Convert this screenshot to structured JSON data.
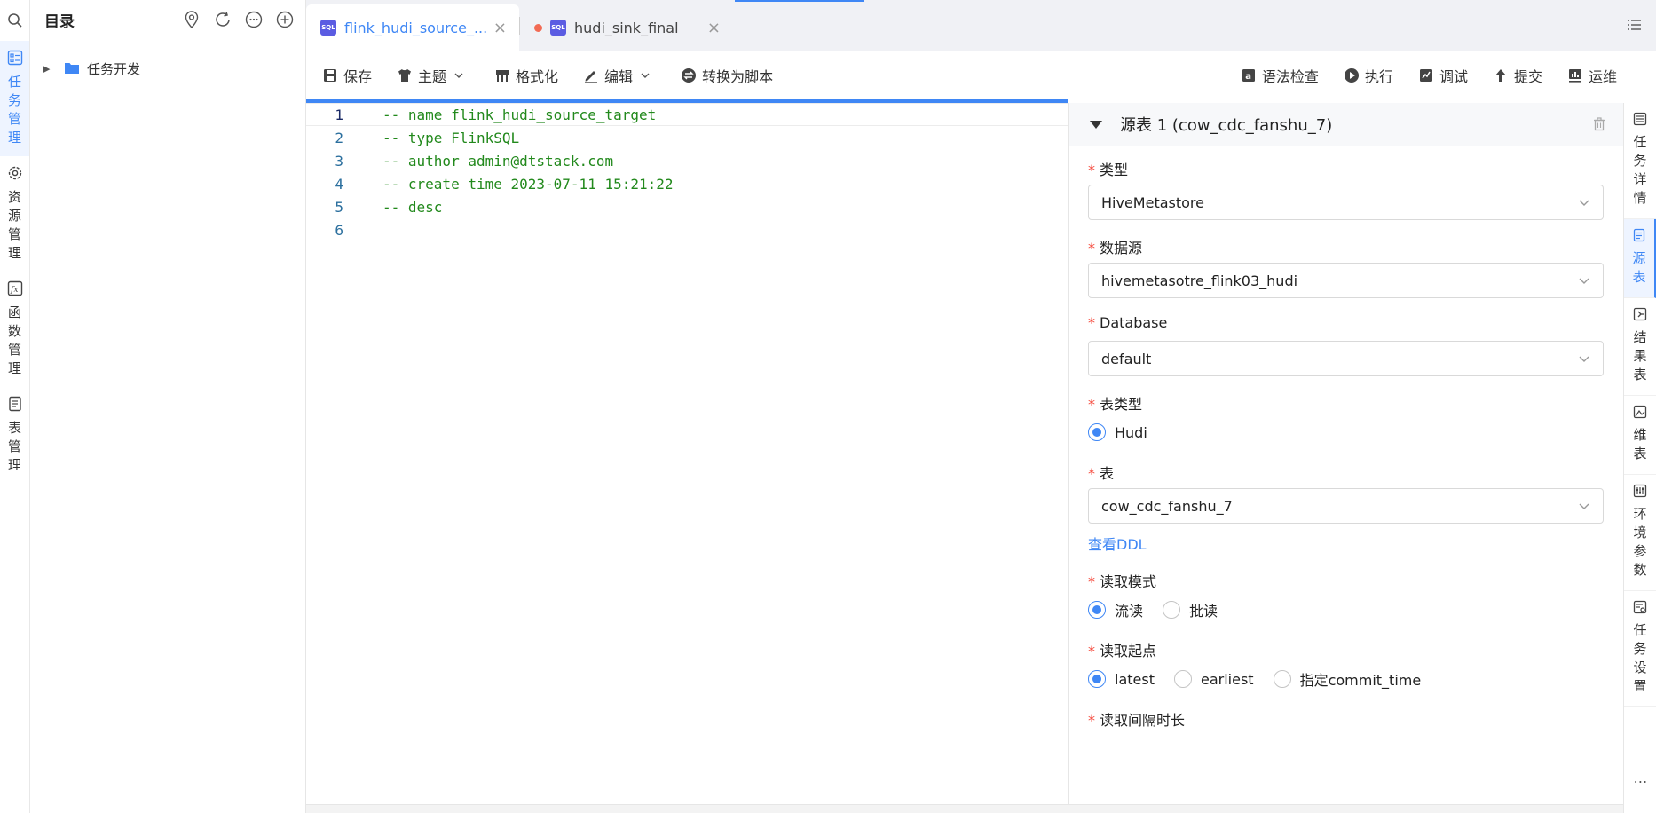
{
  "rail": {
    "items": [
      {
        "label": "任务管理",
        "chars": [
          "任",
          "务",
          "管",
          "理"
        ],
        "icon": "task-list-icon",
        "active": true
      },
      {
        "label": "资源管理",
        "chars": [
          "资",
          "源",
          "管",
          "理"
        ],
        "icon": "gear-icon",
        "active": false
      },
      {
        "label": "函数管理",
        "chars": [
          "函",
          "数",
          "管",
          "理"
        ],
        "icon": "function-icon",
        "active": false
      },
      {
        "label": "表管理",
        "chars": [
          "表",
          "管",
          "理"
        ],
        "icon": "document-icon",
        "active": false
      }
    ]
  },
  "directory": {
    "title": "目录",
    "tree": [
      {
        "label": "任务开发",
        "expanded": false
      }
    ]
  },
  "tabs": [
    {
      "label": "flink_hudi_source_...",
      "badge": "SQL",
      "active": true,
      "unsaved": false
    },
    {
      "label": "hudi_sink_final",
      "badge": "SQL",
      "active": false,
      "unsaved": true
    }
  ],
  "toolbar": {
    "save": "保存",
    "theme": "主题",
    "format": "格式化",
    "edit": "编辑",
    "convert": "转换为脚本",
    "syntax_check": "语法检查",
    "run": "执行",
    "debug": "调试",
    "submit": "提交",
    "ops": "运维"
  },
  "editor": {
    "current_line": 1,
    "lines": [
      {
        "n": "1",
        "text": "-- name flink_hudi_source_target"
      },
      {
        "n": "2",
        "text": "-- type FlinkSQL"
      },
      {
        "n": "3",
        "text": "-- author admin@dtstack.com"
      },
      {
        "n": "4",
        "text": "-- create time 2023-07-11 15:21:22"
      },
      {
        "n": "5",
        "text": "-- desc"
      },
      {
        "n": "6",
        "text": ""
      }
    ]
  },
  "panel": {
    "title": "源表 1 (cow_cdc_fanshu_7)",
    "fields": {
      "type": {
        "label": "类型",
        "value": "HiveMetastore"
      },
      "datasource": {
        "label": "数据源",
        "value": "hivemetasotre_flink03_hudi"
      },
      "database": {
        "label": "Database",
        "value": "default"
      },
      "table_type": {
        "label": "表类型",
        "options": [
          "Hudi"
        ],
        "selected": "Hudi"
      },
      "table": {
        "label": "表",
        "value": "cow_cdc_fanshu_7",
        "link": "查看DDL"
      },
      "read_mode": {
        "label": "读取模式",
        "options": [
          "流读",
          "批读"
        ],
        "selected": "流读"
      },
      "read_start": {
        "label": "读取起点",
        "options": [
          "latest",
          "earliest",
          "指定commit_time"
        ],
        "selected": "latest"
      },
      "read_interval": {
        "label": "读取间隔时长"
      }
    }
  },
  "side_tabs": [
    {
      "label": "任务详情",
      "chars": [
        "任",
        "务",
        "详",
        "情"
      ],
      "icon": "list-icon",
      "active": false
    },
    {
      "label": "源表",
      "chars": [
        "源",
        "表"
      ],
      "icon": "document-icon",
      "active": true
    },
    {
      "label": "结果表",
      "chars": [
        "结",
        "果",
        "表"
      ],
      "icon": "export-icon",
      "active": false
    },
    {
      "label": "维表",
      "chars": [
        "维",
        "表"
      ],
      "icon": "image-icon",
      "active": false
    },
    {
      "label": "环境参数",
      "chars": [
        "环",
        "境",
        "参",
        "数"
      ],
      "icon": "sliders-icon",
      "active": false
    },
    {
      "label": "任务设置",
      "chars": [
        "任",
        "务",
        "设",
        "置"
      ],
      "icon": "settings-doc-icon",
      "active": false
    }
  ],
  "colors": {
    "accent": "#3f87f5",
    "code": "#22891c",
    "required": "#f5483b",
    "unsaved_dot": "#f26b54"
  }
}
